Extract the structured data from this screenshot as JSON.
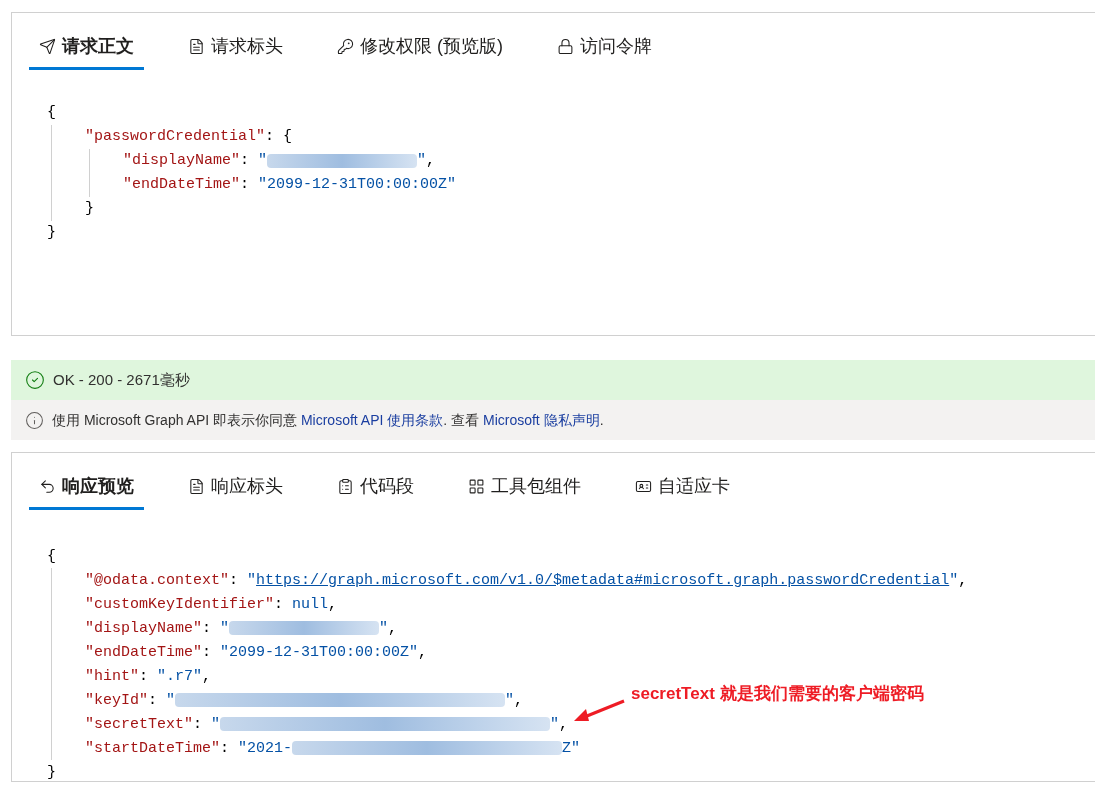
{
  "request": {
    "tabs": [
      {
        "label": "请求正文",
        "selected": true
      },
      {
        "label": "请求标头",
        "selected": false
      },
      {
        "label": "修改权限 (预览版)",
        "selected": false
      },
      {
        "label": "访问令牌",
        "selected": false
      }
    ],
    "code": [
      {
        "tokens": [
          {
            "kind": "punct",
            "text": "{"
          }
        ],
        "children": [
          {
            "tokens": [
              {
                "kind": "key",
                "text": "\"passwordCredential\""
              },
              {
                "kind": "punct",
                "text": ": {"
              }
            ],
            "children": [
              {
                "tokens": [
                  {
                    "kind": "key",
                    "text": "\"displayName\""
                  },
                  {
                    "kind": "punct",
                    "text": ": "
                  },
                  {
                    "kind": "string",
                    "text": "\""
                  },
                  {
                    "kind": "blur_s"
                  },
                  {
                    "kind": "string",
                    "text": "\""
                  },
                  {
                    "kind": "punct",
                    "text": ","
                  }
                ]
              },
              {
                "tokens": [
                  {
                    "kind": "key",
                    "text": "\"endDateTime\""
                  },
                  {
                    "kind": "punct",
                    "text": ": "
                  },
                  {
                    "kind": "string",
                    "text": "\"2099-12-31T00:00:00Z\""
                  }
                ]
              }
            ]
          },
          {
            "tokens": [
              {
                "kind": "punct",
                "text": "}"
              }
            ]
          }
        ]
      },
      {
        "tokens": [
          {
            "kind": "punct",
            "text": "}"
          }
        ]
      }
    ]
  },
  "status": {
    "text": "OK - 200 - 2671毫秒"
  },
  "notice": {
    "segments": [
      {
        "text": "使用 Microsoft Graph API 即表示你同意 ",
        "kind": "text"
      },
      {
        "text": "Microsoft API 使用条款",
        "kind": "link"
      },
      {
        "text": ". 查看 ",
        "kind": "text"
      },
      {
        "text": "Microsoft 隐私声明",
        "kind": "link"
      },
      {
        "text": ".",
        "kind": "text"
      }
    ]
  },
  "response": {
    "tabs": [
      {
        "label": "响应预览",
        "selected": true
      },
      {
        "label": "响应标头",
        "selected": false
      },
      {
        "label": "代码段",
        "selected": false
      },
      {
        "label": "工具包组件",
        "selected": false
      },
      {
        "label": "自适应卡",
        "selected": false
      }
    ],
    "code": [
      {
        "tokens": [
          {
            "kind": "punct",
            "text": "{"
          }
        ],
        "children": [
          {
            "tokens": [
              {
                "kind": "key",
                "text": "\"@odata.context\""
              },
              {
                "kind": "punct",
                "text": ": "
              },
              {
                "kind": "string",
                "text": "\""
              },
              {
                "kind": "link",
                "text": "https://graph.microsoft.com/v1.0/$metadata#microsoft.graph.passwordCredential"
              },
              {
                "kind": "string",
                "text": "\""
              },
              {
                "kind": "punct",
                "text": ","
              }
            ]
          },
          {
            "tokens": [
              {
                "kind": "key",
                "text": "\"customKeyIdentifier\""
              },
              {
                "kind": "punct",
                "text": ": "
              },
              {
                "kind": "string",
                "text": "null"
              },
              {
                "kind": "punct",
                "text": ","
              }
            ]
          },
          {
            "tokens": [
              {
                "kind": "key",
                "text": "\"displayName\""
              },
              {
                "kind": "punct",
                "text": ": "
              },
              {
                "kind": "string",
                "text": "\""
              },
              {
                "kind": "blur_s"
              },
              {
                "kind": "string",
                "text": "\""
              },
              {
                "kind": "punct",
                "text": ","
              }
            ]
          },
          {
            "tokens": [
              {
                "kind": "key",
                "text": "\"endDateTime\""
              },
              {
                "kind": "punct",
                "text": ": "
              },
              {
                "kind": "string",
                "text": "\"2099-12-31T00:00:00Z\""
              },
              {
                "kind": "punct",
                "text": ","
              }
            ]
          },
          {
            "tokens": [
              {
                "kind": "key",
                "text": "\"hint\""
              },
              {
                "kind": "punct",
                "text": ": "
              },
              {
                "kind": "string",
                "text": "\".r7\""
              },
              {
                "kind": "punct",
                "text": ","
              }
            ]
          },
          {
            "tokens": [
              {
                "kind": "key",
                "text": "\"keyId\""
              },
              {
                "kind": "punct",
                "text": ": "
              },
              {
                "kind": "string",
                "text": "\""
              },
              {
                "kind": "blur_l"
              },
              {
                "kind": "string",
                "text": "\""
              },
              {
                "kind": "punct",
                "text": ","
              }
            ]
          },
          {
            "tokens": [
              {
                "kind": "key",
                "text": "\"secretText\""
              },
              {
                "kind": "punct",
                "text": ": "
              },
              {
                "kind": "string",
                "text": "\""
              },
              {
                "kind": "blur_l"
              },
              {
                "kind": "string",
                "text": "\""
              },
              {
                "kind": "punct",
                "text": ","
              }
            ]
          },
          {
            "tokens": [
              {
                "kind": "key",
                "text": "\"startDateTime\""
              },
              {
                "kind": "punct",
                "text": ": "
              },
              {
                "kind": "string",
                "text": "\"2021-"
              },
              {
                "kind": "blur_m"
              },
              {
                "kind": "string",
                "text": "Z\""
              }
            ]
          }
        ]
      },
      {
        "tokens": [
          {
            "kind": "punct",
            "text": "}"
          }
        ]
      }
    ]
  },
  "annotation": {
    "text": "secretText 就是我们需要的客户端密码"
  }
}
